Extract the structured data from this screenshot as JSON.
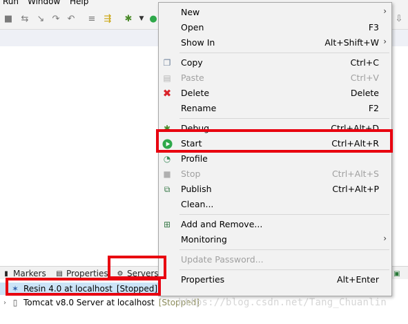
{
  "menubar": {
    "items": [
      "Run",
      "Window",
      "Help"
    ]
  },
  "context_menu": {
    "items": [
      {
        "label": "New",
        "accel": "",
        "submenu": true,
        "icon": "none",
        "disabled": false
      },
      {
        "label": "Open",
        "accel": "F3",
        "submenu": false,
        "icon": "none",
        "disabled": false
      },
      {
        "label": "Show In",
        "accel": "Alt+Shift+W",
        "submenu": true,
        "icon": "none",
        "disabled": false
      },
      {
        "label": "Copy",
        "accel": "Ctrl+C",
        "submenu": false,
        "icon": "copy-icon",
        "disabled": false
      },
      {
        "label": "Paste",
        "accel": "Ctrl+V",
        "submenu": false,
        "icon": "paste-icon",
        "disabled": true
      },
      {
        "label": "Delete",
        "accel": "Delete",
        "submenu": false,
        "icon": "delete-icon",
        "disabled": false
      },
      {
        "label": "Rename",
        "accel": "F2",
        "submenu": false,
        "icon": "none",
        "disabled": false
      },
      {
        "label": "Debug",
        "accel": "Ctrl+Alt+D",
        "submenu": false,
        "icon": "debug-icon",
        "disabled": false
      },
      {
        "label": "Start",
        "accel": "Ctrl+Alt+R",
        "submenu": false,
        "icon": "start-icon",
        "disabled": false
      },
      {
        "label": "Profile",
        "accel": "",
        "submenu": false,
        "icon": "profile-icon",
        "disabled": false
      },
      {
        "label": "Stop",
        "accel": "Ctrl+Alt+S",
        "submenu": false,
        "icon": "stop-icon",
        "disabled": true
      },
      {
        "label": "Publish",
        "accel": "Ctrl+Alt+P",
        "submenu": false,
        "icon": "publish-icon",
        "disabled": false
      },
      {
        "label": "Clean...",
        "accel": "",
        "submenu": false,
        "icon": "none",
        "disabled": false
      },
      {
        "label": "Add and Remove...",
        "accel": "",
        "submenu": false,
        "icon": "add-remove-icon",
        "disabled": false
      },
      {
        "label": "Monitoring",
        "accel": "",
        "submenu": true,
        "icon": "none",
        "disabled": false
      },
      {
        "label": "Update Password...",
        "accel": "",
        "submenu": false,
        "icon": "none",
        "disabled": true
      },
      {
        "label": "Properties",
        "accel": "Alt+Enter",
        "submenu": false,
        "icon": "none",
        "disabled": false
      }
    ]
  },
  "view_tabs": {
    "markers": "Markers",
    "properties": "Properties",
    "servers": "Servers"
  },
  "servers": [
    {
      "name": "Resin 4.0 at localhost",
      "state": "[Stopped]",
      "selected": true
    },
    {
      "name": "Tomcat v8.0 Server at localhost",
      "state": "[Stopped]",
      "selected": false
    }
  ],
  "watermark": "https://blog.csdn.net/Tang_Chuanlin",
  "colors": {
    "highlight": "#e8000f",
    "menu_bg": "#f2f2f2",
    "disabled_text": "#a0a0a0",
    "start_green": "#2ea84a",
    "delete_red": "#d9232a"
  }
}
